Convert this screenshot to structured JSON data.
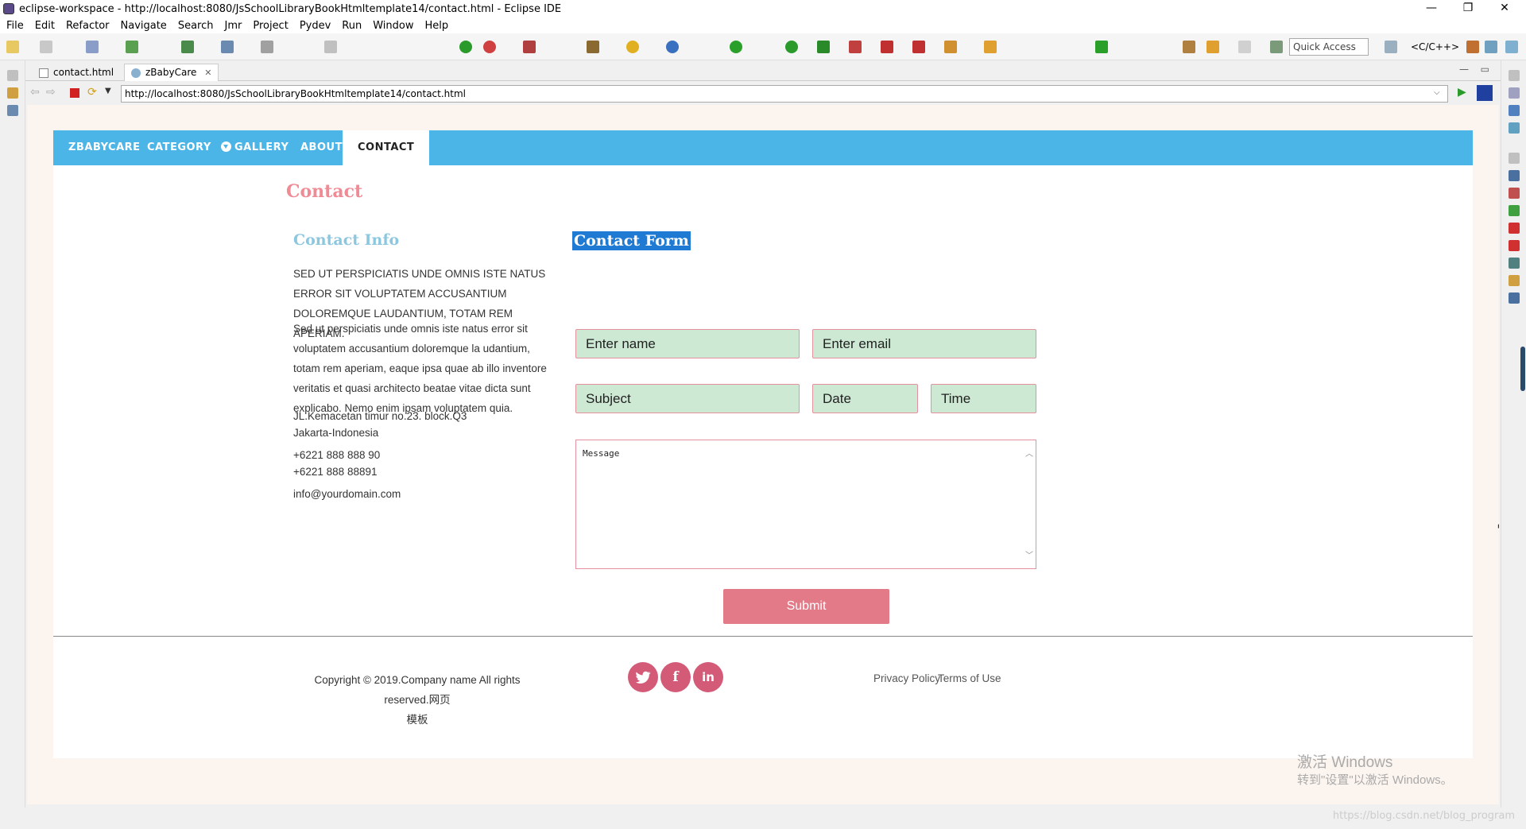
{
  "window": {
    "title": "eclipse-workspace - http://localhost:8080/JsSchoolLibraryBookHtmltemplate14/contact.html - Eclipse IDE",
    "controls": [
      "—",
      "❐",
      "✕"
    ]
  },
  "menu": [
    "File",
    "Edit",
    "Refactor",
    "Navigate",
    "Search",
    "Jmr",
    "Project",
    "Pydev",
    "Run",
    "Window",
    "Help"
  ],
  "toolbar": {
    "quick_access": "Quick Access",
    "perspective": "<C/C++>"
  },
  "editor_tabs": [
    {
      "label": "contact.html",
      "active": false
    },
    {
      "label": "zBabyCare",
      "active": true
    }
  ],
  "browser": {
    "url": "http://localhost:8080/JsSchoolLibraryBookHtmltemplate14/contact.html"
  },
  "site": {
    "nav": [
      "ZBABYCARE",
      "CATEGORY",
      "GALLERY",
      "ABOUT",
      "CONTACT"
    ],
    "page_title": "Contact",
    "info_heading": "Contact Info",
    "form_heading": "Contact Form",
    "info_paragraph_1": "SED UT PERSPICIATIS UNDE OMNIS ISTE NATUS ERROR SIT VOLUPTATEM ACCUSANTIUM DOLOREMQUE LAUDANTIUM, TOTAM REM APERIAM.",
    "info_paragraph_2": "Sed ut perspiciatis unde omnis iste natus error sit voluptatem accusantium doloremque la udantium, totam rem aperiam, eaque ipsa quae ab illo inventore veritatis et quasi architecto beatae vitae dicta sunt explicabo. Nemo enim ipsam voluptatem quia.",
    "address_line_1": "JL.Kemacetan timur no.23. block.Q3",
    "address_line_2": "Jakarta-Indonesia",
    "phone_1": "+6221 888 888 90",
    "phone_2": "+6221 888 88891",
    "email": "info@yourdomain.com",
    "form": {
      "name_placeholder": "Enter name",
      "email_placeholder": "Enter email",
      "subject_placeholder": "Subject",
      "date_placeholder": "Date",
      "time_placeholder": "Time",
      "message_placeholder": "Message",
      "submit_label": "Submit"
    },
    "footer": {
      "copyright_1": "Copyright © 2019.Company name All rights reserved.网页",
      "copyright_2": "模板",
      "social": [
        "twitter-icon",
        "facebook-icon",
        "linkedin-icon"
      ],
      "links": [
        "Privacy Policy",
        "Terms of Use"
      ]
    }
  },
  "watermark": {
    "line1": "激活 Windows",
    "line2": "转到\"设置\"以激活 Windows。"
  },
  "status": {
    "csdn": "https://blog.csdn.net/blog_program"
  },
  "colors": {
    "nav": "#4cb5e8",
    "accent_pink": "#e27a88",
    "field_green": "#cde8d3",
    "page_title": "#f08b96",
    "info_heading": "#8cc7e0"
  }
}
